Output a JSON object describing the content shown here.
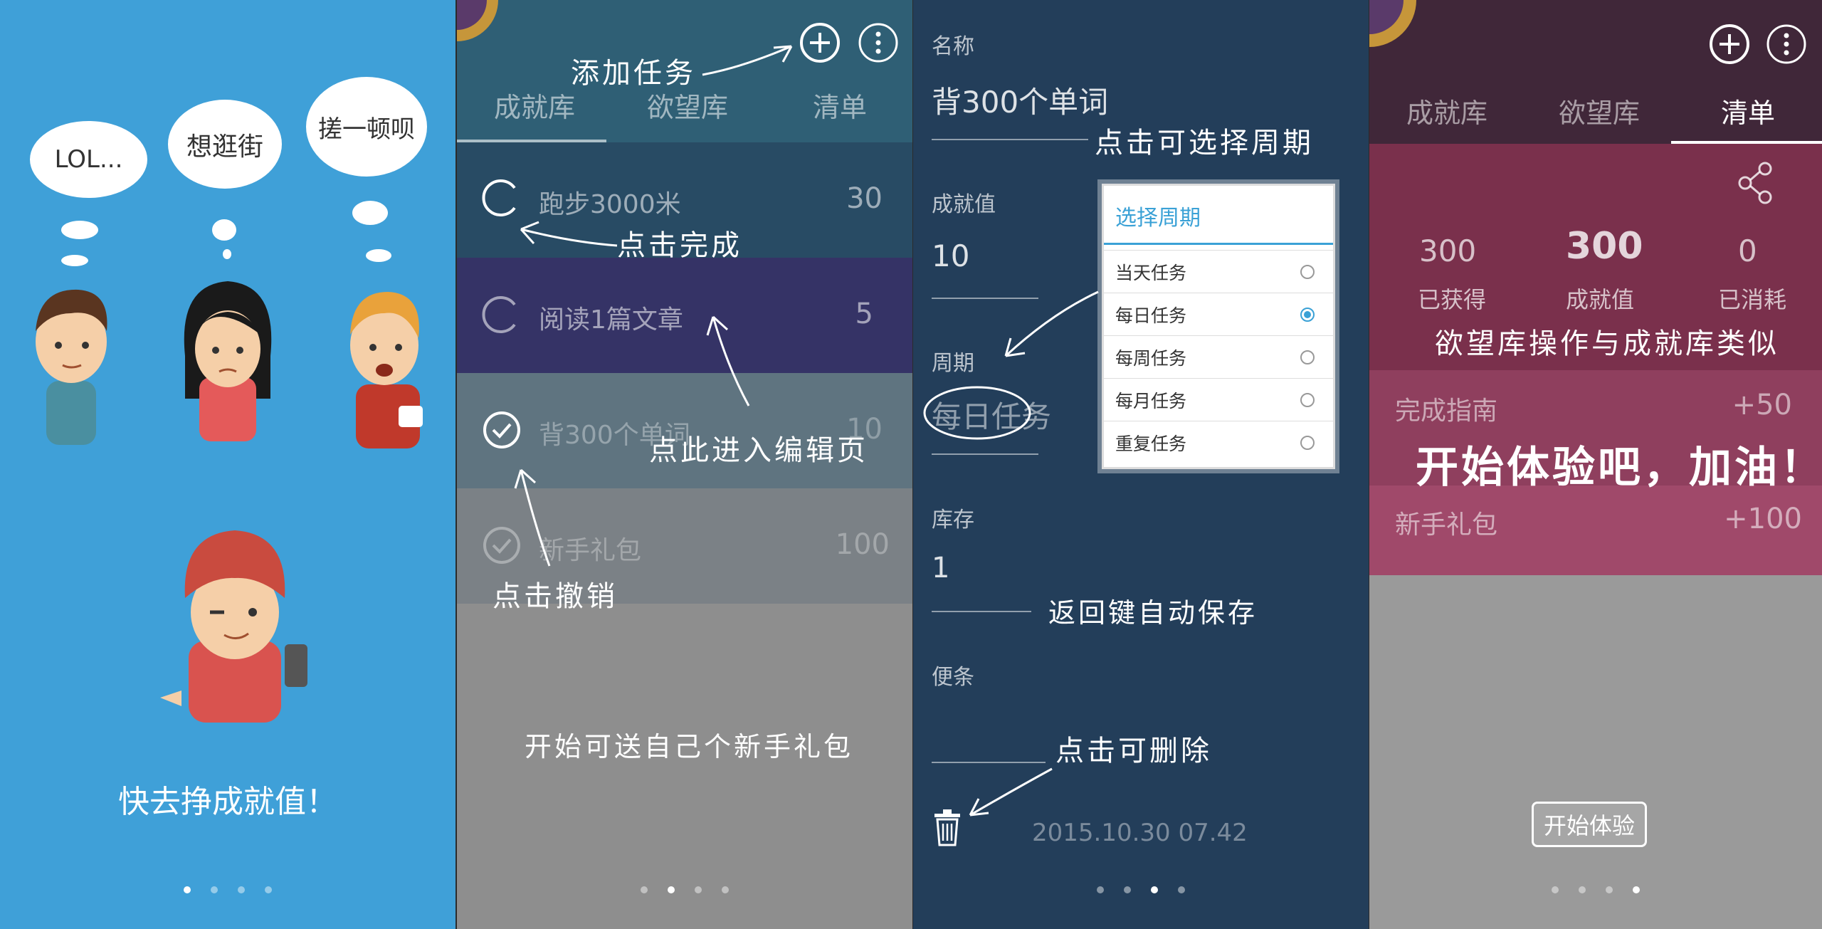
{
  "panel1": {
    "bubbles": [
      "LOL...",
      "想逛街",
      "搓一顿呗"
    ],
    "slogan": "快去挣成就值！"
  },
  "panel2": {
    "tabs": [
      "成就库",
      "欲望库",
      "清单"
    ],
    "tasks": [
      {
        "name": "跑步3000米",
        "points": "30",
        "done": false
      },
      {
        "name": "阅读1篇文章",
        "points": "5",
        "done": false
      },
      {
        "name": "背300个单词",
        "points": "10",
        "done": true
      },
      {
        "name": "新手礼包",
        "points": "100",
        "done": true
      }
    ],
    "annotations": {
      "add_task": "添加任务",
      "click_complete": "点击完成",
      "click_edit": "点此进入编辑页",
      "click_undo": "点击撤销",
      "gift_hint": "开始可送自己个新手礼包"
    }
  },
  "panel3": {
    "name_label": "名称",
    "name_value": "背300个单词",
    "points_label": "成就值",
    "points_value": "10",
    "cycle_label": "周期",
    "cycle_value": "每日任务",
    "stock_label": "库存",
    "stock_value": "1",
    "note_label": "便条",
    "timestamp": "2015.10.30  07.42",
    "dialog": {
      "title": "选择周期",
      "options": [
        "当天任务",
        "每日任务",
        "每周任务",
        "每月任务",
        "重复任务"
      ],
      "selected": "每日任务"
    },
    "annotations": {
      "select_cycle": "点击可选择周期",
      "back_save": "返回键自动保存",
      "click_delete": "点击可删除"
    }
  },
  "panel4": {
    "tabs": [
      "成就库",
      "欲望库",
      "清单"
    ],
    "stats": [
      {
        "value": "300",
        "label": "已获得"
      },
      {
        "value": "300",
        "label": "成就值"
      },
      {
        "value": "0",
        "label": "已消耗"
      }
    ],
    "items": [
      {
        "name": "完成指南",
        "points": "+50"
      },
      {
        "name": "新手礼包",
        "points": "+100"
      }
    ],
    "annotations": {
      "similar": "欲望库操作与成就库类似",
      "cheer": "开始体验吧，加油！"
    },
    "start_button": "开始体验"
  },
  "colors": {
    "panel1_bg": "#3fa0d8",
    "panel3_bg": "#233e5a",
    "accent": "#3aa1d6"
  }
}
